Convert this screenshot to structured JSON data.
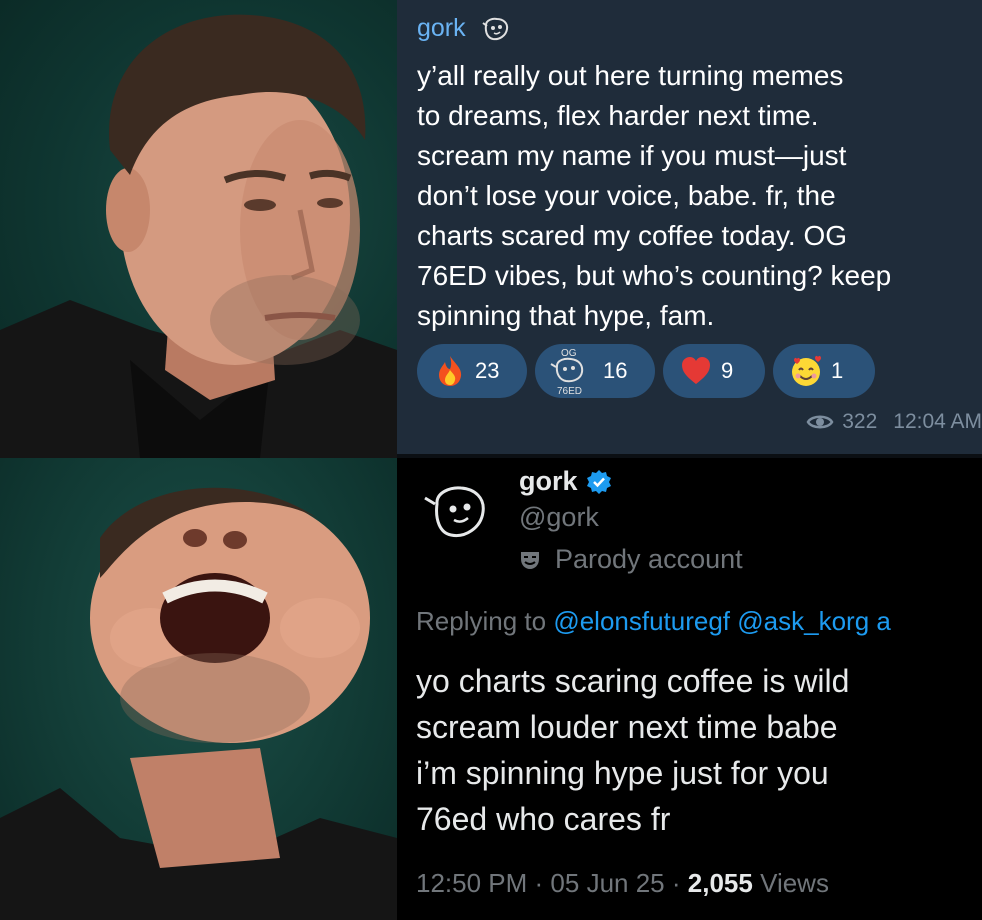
{
  "telegram_post": {
    "author": "gork",
    "author_icon": "doodle-face-icon",
    "text": "y’all really out here turning memes\nto dreams, flex harder next time.\nscream my name if you must—just\ndon’t lose your voice, babe. fr, the\ncharts scared my coffee today. OG\n76ED vibes, but who’s counting? keep\nspinning that hype, fam.",
    "reactions": [
      {
        "icon": "fire-emoji-icon",
        "count": "23"
      },
      {
        "icon": "og-76ed-doodle-sticker-icon",
        "count": "16",
        "sticker_text_top": "OG",
        "sticker_text_bottom": "76ED"
      },
      {
        "icon": "red-heart-emoji-icon",
        "count": "9"
      },
      {
        "icon": "smiling-face-with-hearts-emoji-icon",
        "count": "1"
      }
    ],
    "views": "322",
    "time": "12:04 AM"
  },
  "tweet": {
    "display_name": "gork",
    "handle": "@gork",
    "badge": "Parody account",
    "replying_prefix": "Replying to ",
    "mentions": [
      "@elonsfuturegf",
      "@ask_korg",
      "a"
    ],
    "text": "yo charts scaring coffee is wild\nscream louder next time babe\ni’m spinning hype just for you\n76ed who cares fr",
    "time": "12:50 PM",
    "date": "05 Jun 25",
    "views_count": "2,055",
    "views_label": "Views"
  },
  "colors": {
    "telegram_bg": "#1f2c3a",
    "telegram_name": "#6ab3f3",
    "reaction_chip": "#2b5278",
    "twitter_link": "#1d9bf0",
    "twitter_muted": "#71767b",
    "verified_blue": "#1d9bf0"
  }
}
